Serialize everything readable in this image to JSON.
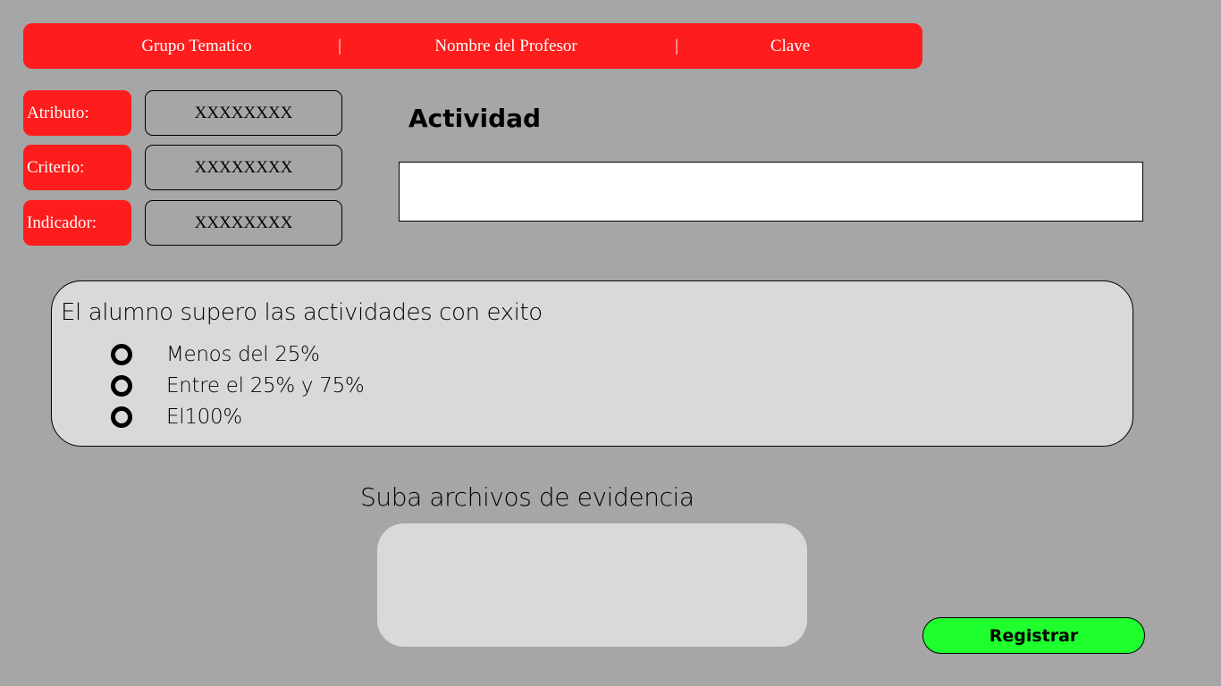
{
  "header": {
    "items": [
      "Grupo Tematico",
      "Nombre del Profesor",
      "Clave"
    ],
    "separator": "|",
    "color": "#ff1c1c"
  },
  "fields": [
    {
      "label": "Atributo:",
      "value": "XXXXXXXX"
    },
    {
      "label": "Criterio:",
      "value": "XXXXXXXX"
    },
    {
      "label": "Indicador:",
      "value": "XXXXXXXX"
    }
  ],
  "activity": {
    "title": "Actividad",
    "value": ""
  },
  "assessment": {
    "question": "El alumno supero las actividades con exito",
    "options": [
      "Menos del 25%",
      "Entre el 25% y 75%",
      "El100%"
    ]
  },
  "upload": {
    "title": "Suba archivos de evidencia"
  },
  "submit": {
    "label": "Registrar",
    "color": "#1fff2e"
  }
}
